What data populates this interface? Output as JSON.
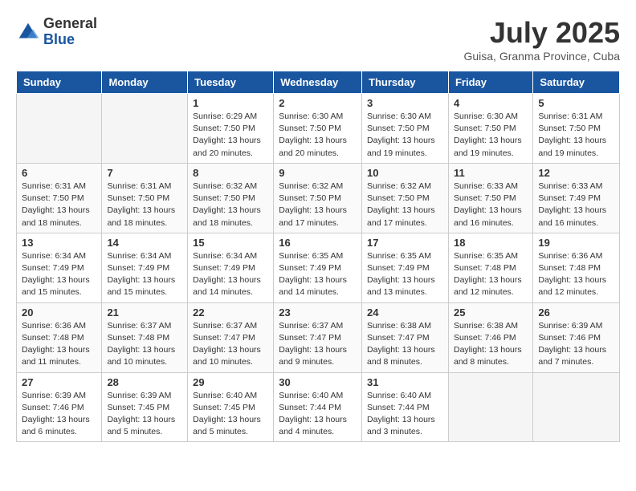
{
  "header": {
    "logo_general": "General",
    "logo_blue": "Blue",
    "month_title": "July 2025",
    "location": "Guisa, Granma Province, Cuba"
  },
  "days_of_week": [
    "Sunday",
    "Monday",
    "Tuesday",
    "Wednesday",
    "Thursday",
    "Friday",
    "Saturday"
  ],
  "weeks": [
    [
      {
        "day": "",
        "empty": true
      },
      {
        "day": "",
        "empty": true
      },
      {
        "day": "1",
        "sunrise": "6:29 AM",
        "sunset": "7:50 PM",
        "daylight": "13 hours and 20 minutes."
      },
      {
        "day": "2",
        "sunrise": "6:30 AM",
        "sunset": "7:50 PM",
        "daylight": "13 hours and 20 minutes."
      },
      {
        "day": "3",
        "sunrise": "6:30 AM",
        "sunset": "7:50 PM",
        "daylight": "13 hours and 19 minutes."
      },
      {
        "day": "4",
        "sunrise": "6:30 AM",
        "sunset": "7:50 PM",
        "daylight": "13 hours and 19 minutes."
      },
      {
        "day": "5",
        "sunrise": "6:31 AM",
        "sunset": "7:50 PM",
        "daylight": "13 hours and 19 minutes."
      }
    ],
    [
      {
        "day": "6",
        "sunrise": "6:31 AM",
        "sunset": "7:50 PM",
        "daylight": "13 hours and 18 minutes."
      },
      {
        "day": "7",
        "sunrise": "6:31 AM",
        "sunset": "7:50 PM",
        "daylight": "13 hours and 18 minutes."
      },
      {
        "day": "8",
        "sunrise": "6:32 AM",
        "sunset": "7:50 PM",
        "daylight": "13 hours and 18 minutes."
      },
      {
        "day": "9",
        "sunrise": "6:32 AM",
        "sunset": "7:50 PM",
        "daylight": "13 hours and 17 minutes."
      },
      {
        "day": "10",
        "sunrise": "6:32 AM",
        "sunset": "7:50 PM",
        "daylight": "13 hours and 17 minutes."
      },
      {
        "day": "11",
        "sunrise": "6:33 AM",
        "sunset": "7:50 PM",
        "daylight": "13 hours and 16 minutes."
      },
      {
        "day": "12",
        "sunrise": "6:33 AM",
        "sunset": "7:49 PM",
        "daylight": "13 hours and 16 minutes."
      }
    ],
    [
      {
        "day": "13",
        "sunrise": "6:34 AM",
        "sunset": "7:49 PM",
        "daylight": "13 hours and 15 minutes."
      },
      {
        "day": "14",
        "sunrise": "6:34 AM",
        "sunset": "7:49 PM",
        "daylight": "13 hours and 15 minutes."
      },
      {
        "day": "15",
        "sunrise": "6:34 AM",
        "sunset": "7:49 PM",
        "daylight": "13 hours and 14 minutes."
      },
      {
        "day": "16",
        "sunrise": "6:35 AM",
        "sunset": "7:49 PM",
        "daylight": "13 hours and 14 minutes."
      },
      {
        "day": "17",
        "sunrise": "6:35 AM",
        "sunset": "7:49 PM",
        "daylight": "13 hours and 13 minutes."
      },
      {
        "day": "18",
        "sunrise": "6:35 AM",
        "sunset": "7:48 PM",
        "daylight": "13 hours and 12 minutes."
      },
      {
        "day": "19",
        "sunrise": "6:36 AM",
        "sunset": "7:48 PM",
        "daylight": "13 hours and 12 minutes."
      }
    ],
    [
      {
        "day": "20",
        "sunrise": "6:36 AM",
        "sunset": "7:48 PM",
        "daylight": "13 hours and 11 minutes."
      },
      {
        "day": "21",
        "sunrise": "6:37 AM",
        "sunset": "7:48 PM",
        "daylight": "13 hours and 10 minutes."
      },
      {
        "day": "22",
        "sunrise": "6:37 AM",
        "sunset": "7:47 PM",
        "daylight": "13 hours and 10 minutes."
      },
      {
        "day": "23",
        "sunrise": "6:37 AM",
        "sunset": "7:47 PM",
        "daylight": "13 hours and 9 minutes."
      },
      {
        "day": "24",
        "sunrise": "6:38 AM",
        "sunset": "7:47 PM",
        "daylight": "13 hours and 8 minutes."
      },
      {
        "day": "25",
        "sunrise": "6:38 AM",
        "sunset": "7:46 PM",
        "daylight": "13 hours and 8 minutes."
      },
      {
        "day": "26",
        "sunrise": "6:39 AM",
        "sunset": "7:46 PM",
        "daylight": "13 hours and 7 minutes."
      }
    ],
    [
      {
        "day": "27",
        "sunrise": "6:39 AM",
        "sunset": "7:46 PM",
        "daylight": "13 hours and 6 minutes."
      },
      {
        "day": "28",
        "sunrise": "6:39 AM",
        "sunset": "7:45 PM",
        "daylight": "13 hours and 5 minutes."
      },
      {
        "day": "29",
        "sunrise": "6:40 AM",
        "sunset": "7:45 PM",
        "daylight": "13 hours and 5 minutes."
      },
      {
        "day": "30",
        "sunrise": "6:40 AM",
        "sunset": "7:44 PM",
        "daylight": "13 hours and 4 minutes."
      },
      {
        "day": "31",
        "sunrise": "6:40 AM",
        "sunset": "7:44 PM",
        "daylight": "13 hours and 3 minutes."
      },
      {
        "day": "",
        "empty": true
      },
      {
        "day": "",
        "empty": true
      }
    ]
  ],
  "labels": {
    "sunrise": "Sunrise:",
    "sunset": "Sunset:",
    "daylight": "Daylight:"
  }
}
